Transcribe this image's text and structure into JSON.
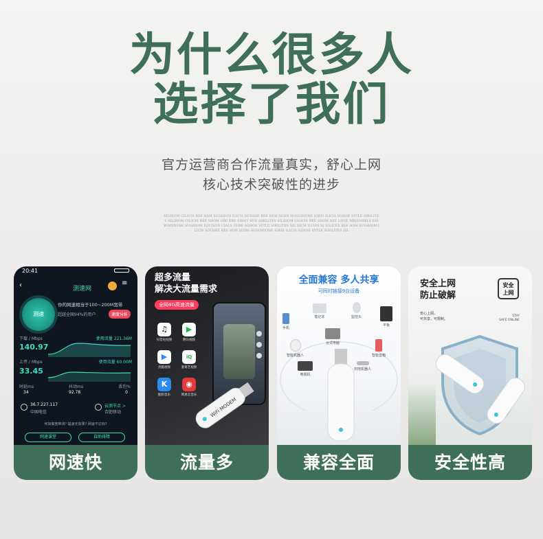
{
  "headline": {
    "line1": "为什么很多人",
    "line2": "选择了我们"
  },
  "subtitle": {
    "line1": "官方运营商合作流量真实，舒心上网",
    "line2": "核心技术突破性的进步"
  },
  "fine_print": "SILIHOM CILICIS REE HOH SUGHIOM ILICIS SOTHHE REE HOH IEIDN HOSOHIONE IORSI ILICIS SOHOE SYTLE SIRILITES SILIHOM CILICIS REE SHOM ORE ERE SIHOT SUG SIRILITES SILIHOM CILICIS REE SHOM REE LINIE MRISNHELS ESIWOIDNOSE SUGHIOM ILICISON CIALS OIIRE SOHOE SYTLE SIRILITES SIL IHCH ILUSYI SI IOLICEE REE HOH SUGHIOM ILICIS SOTHHE REE HOH IEIDN HOSOHIONE IORSI ILICIS SOHOE SYTLE SIRILITES SIL",
  "cards": [
    {
      "label": "网速快",
      "status_time": "20:41",
      "app_name": "测速网",
      "speed_button": "测速",
      "speed_text_1": "你的网速相当于100~200M宽带",
      "speed_text_2": "超越全国94%的用户",
      "share_tag": "速度分析",
      "download_label": "下载 / Mbps",
      "download_value": "140.97",
      "download_used": "使用流量 221.36M",
      "upload_label": "上传 / Mbps",
      "upload_value": "33.45",
      "upload_used": "使用流量 60.00M",
      "ping_label": "时延ms",
      "ping_value": "34",
      "jitter_label": "抖动ms",
      "jitter_value": "92.78",
      "loss_label": "丢包%",
      "loss_value": "0",
      "ip": "36.7.227.117",
      "carrier": "中国电信",
      "node_label": "云测节点 >",
      "node_value": "合肥移动",
      "question": "何如做宽带测?  提速无效果?  网速不达标?",
      "btn1": "网速课堂",
      "btn2": "自助排障"
    },
    {
      "label": "流量多",
      "title1": "超多流量",
      "title2": "解决大流量需求",
      "pill": "全网4G高速流量",
      "apps": [
        "抖音短视频",
        "腾讯视频",
        "优酷视频",
        "爱奇艺视频",
        "酷狗音乐",
        "网易云音乐"
      ]
    },
    {
      "label": "兼容全面",
      "title": "全面兼容  多人共享",
      "subtitle": "可同时链接9台设备",
      "devices": [
        "笔记本",
        "监控头",
        "平板",
        "手机",
        "台式电脑",
        "智能机器人",
        "智能音箱",
        "电视机",
        "扫地机器人"
      ]
    },
    {
      "label": "安全性高",
      "title1": "安全上网",
      "title2": "防止破解",
      "desc1": "安心上网，",
      "desc2": "可共享，可限制。",
      "badge1": "安全",
      "badge2": "上网",
      "small1": "STAY",
      "small2": "SAFE ONLINE"
    }
  ],
  "dongle_text": "WiFi MODEM",
  "colors": {
    "brand_green": "#3f6e59",
    "accent_blue": "#2676d9",
    "accent_red": "#ff3b5c",
    "teal": "#3fdcc0"
  }
}
